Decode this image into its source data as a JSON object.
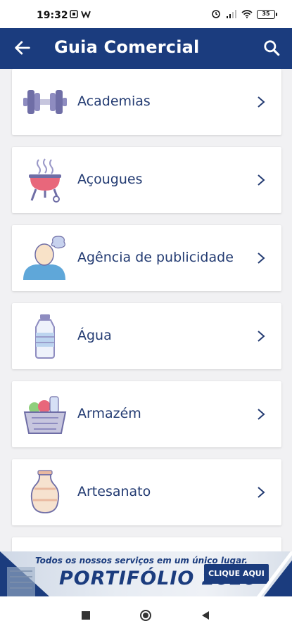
{
  "status_bar": {
    "time": "19:32",
    "battery": "35",
    "left_icons": [
      "notification-icon",
      "app-w-icon"
    ],
    "right_icons": [
      "alarm-icon",
      "signal-icon",
      "wifi-icon",
      "battery-icon"
    ]
  },
  "app_bar": {
    "title": "Guia Comercial",
    "back_icon": "arrow-left-icon",
    "search_icon": "search-icon",
    "color": "#1b3c7e"
  },
  "categories": [
    {
      "label": "Academias",
      "icon": "dumbbell-icon"
    },
    {
      "label": "Açougues",
      "icon": "grill-icon"
    },
    {
      "label": "Agência de publicidade",
      "icon": "person-idea-icon"
    },
    {
      "label": "Água",
      "icon": "water-bottle-icon"
    },
    {
      "label": "Armazém",
      "icon": "grocery-basket-icon"
    },
    {
      "label": "Artesanato",
      "icon": "vase-icon"
    }
  ],
  "banner": {
    "tagline": "Todos os nossos serviços em um único lugar.",
    "headline": "PORTIFÓLIO 2020",
    "cta": "CLIQUE AQUI"
  },
  "nav_bar": {
    "buttons": [
      "recents-icon",
      "home-icon",
      "back-icon"
    ]
  }
}
